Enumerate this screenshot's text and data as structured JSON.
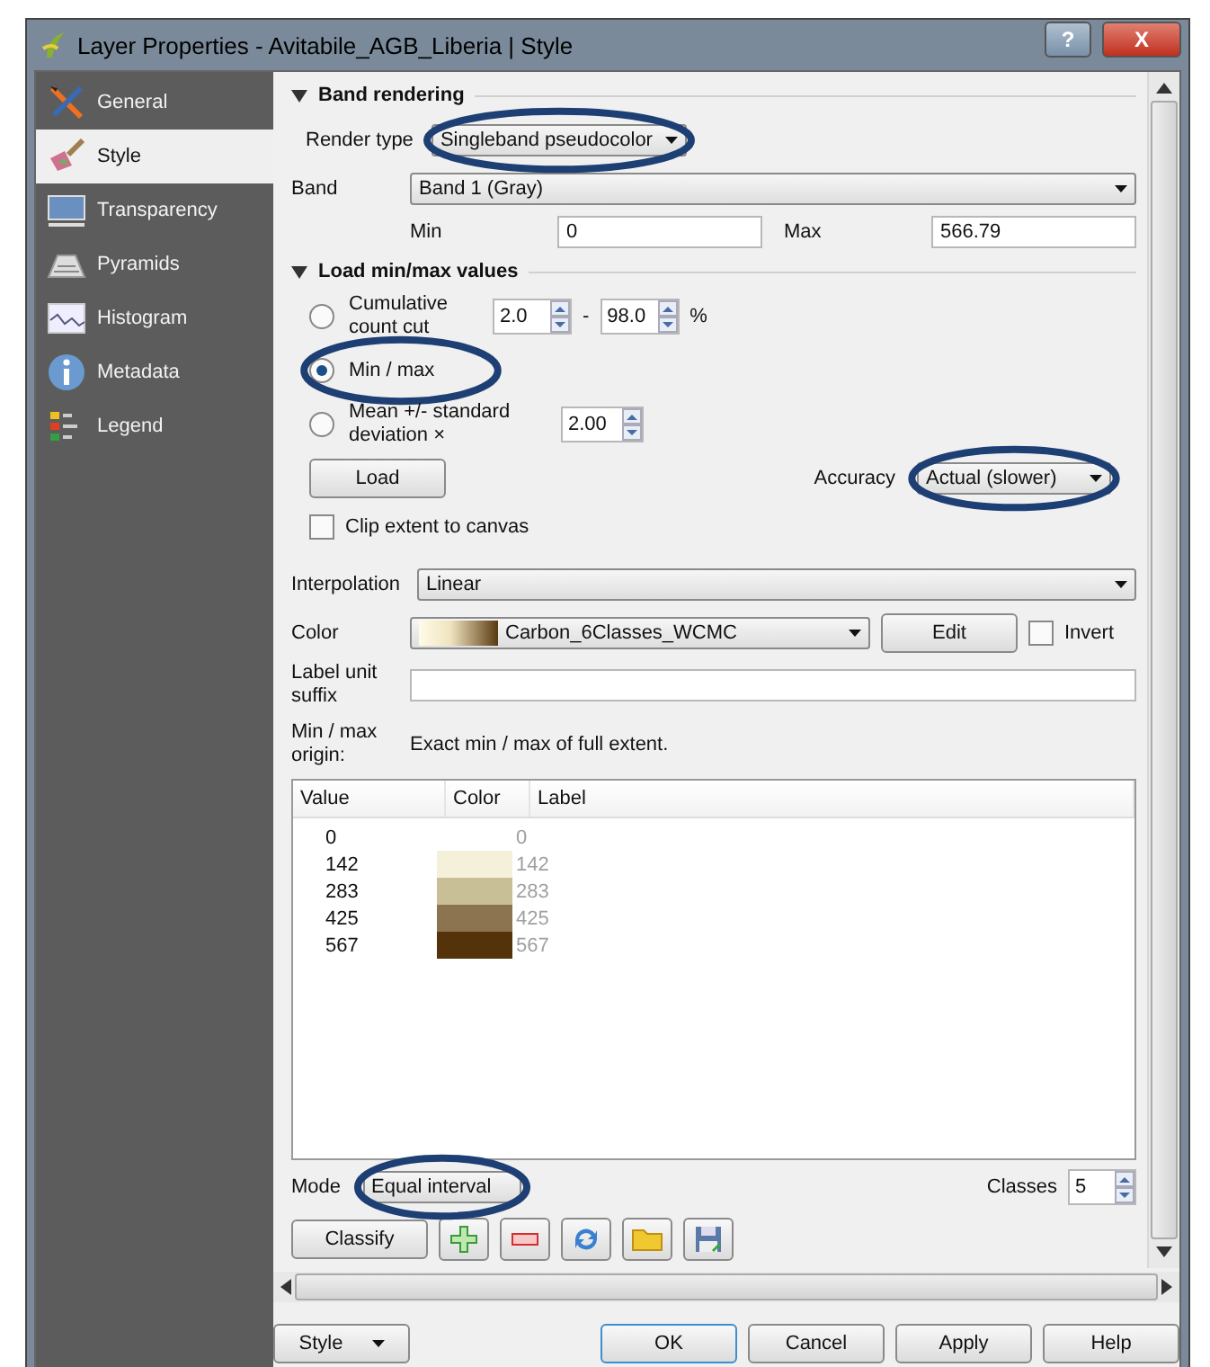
{
  "window": {
    "title": "Layer Properties - Avitabile_AGB_Liberia | Style",
    "help_button": "?",
    "close_button": "X"
  },
  "sidebar": {
    "items": [
      {
        "kind": "general",
        "label": "General",
        "selected": false
      },
      {
        "kind": "style",
        "label": "Style",
        "selected": true
      },
      {
        "kind": "transparency",
        "label": "Transparency",
        "selected": false
      },
      {
        "kind": "pyramids",
        "label": "Pyramids",
        "selected": false
      },
      {
        "kind": "histogram",
        "label": "Histogram",
        "selected": false
      },
      {
        "kind": "metadata",
        "label": "Metadata",
        "selected": false
      },
      {
        "kind": "legend",
        "label": "Legend",
        "selected": false
      }
    ]
  },
  "band_rendering": {
    "title": "Band rendering",
    "render_type": {
      "label": "Render type",
      "value": "Singleband pseudocolor",
      "highlighted": true
    },
    "band": {
      "label": "Band",
      "value": "Band 1 (Gray)"
    },
    "min": {
      "label": "Min",
      "value": "0"
    },
    "max": {
      "label": "Max",
      "value": "566.79"
    }
  },
  "load_minmax": {
    "title": "Load min/max values",
    "options": [
      {
        "kind": "cumulative",
        "label": "Cumulative count cut",
        "selected": false,
        "from": "2.0",
        "separator": "-",
        "to": "98.0",
        "unit": "%"
      },
      {
        "kind": "plain",
        "label": "Min / max",
        "selected": true,
        "highlighted": true
      },
      {
        "kind": "stddev",
        "label": "Mean +/- standard deviation ×",
        "selected": false,
        "value": "2.00"
      }
    ],
    "load_button": "Load",
    "accuracy": {
      "label": "Accuracy",
      "value": "Actual (slower)",
      "highlighted": true
    },
    "clip": {
      "label": "Clip extent to canvas",
      "checked": false
    }
  },
  "interpolation": {
    "label": "Interpolation",
    "value": "Linear"
  },
  "color": {
    "label": "Color",
    "value": "Carbon_6Classes_WCMC",
    "edit_button": "Edit",
    "invert": {
      "label": "Invert",
      "checked": false
    }
  },
  "label_unit_suffix": {
    "label": "Label unit suffix"
  },
  "origin": {
    "label": "Min / max origin:",
    "value": "Exact min / max of full extent."
  },
  "table": {
    "columns": [
      "Value",
      "Color",
      "Label"
    ],
    "rows": [
      {
        "value": "0",
        "label": "0"
      },
      {
        "value": "142",
        "color": "#f5f0da",
        "label": "142"
      },
      {
        "value": "283",
        "color": "#c9bf97",
        "label": "283"
      },
      {
        "value": "425",
        "color": "#8c7450",
        "label": "425"
      },
      {
        "value": "567",
        "color": "#55330a",
        "label": "567"
      }
    ]
  },
  "mode": {
    "label": "Mode",
    "value": "Equal interval",
    "highlighted": true
  },
  "classes": {
    "label": "Classes",
    "value": "5"
  },
  "classify_button": "Classify",
  "tool_buttons": [
    {
      "kind": "add"
    },
    {
      "kind": "remove"
    },
    {
      "kind": "refresh"
    },
    {
      "kind": "open"
    },
    {
      "kind": "save"
    }
  ],
  "footer": {
    "style_button": "Style",
    "buttons": [
      {
        "label": "OK",
        "default": true
      },
      {
        "label": "Cancel",
        "default": false
      },
      {
        "label": "Apply",
        "default": false
      },
      {
        "label": "Help",
        "default": false
      }
    ]
  }
}
